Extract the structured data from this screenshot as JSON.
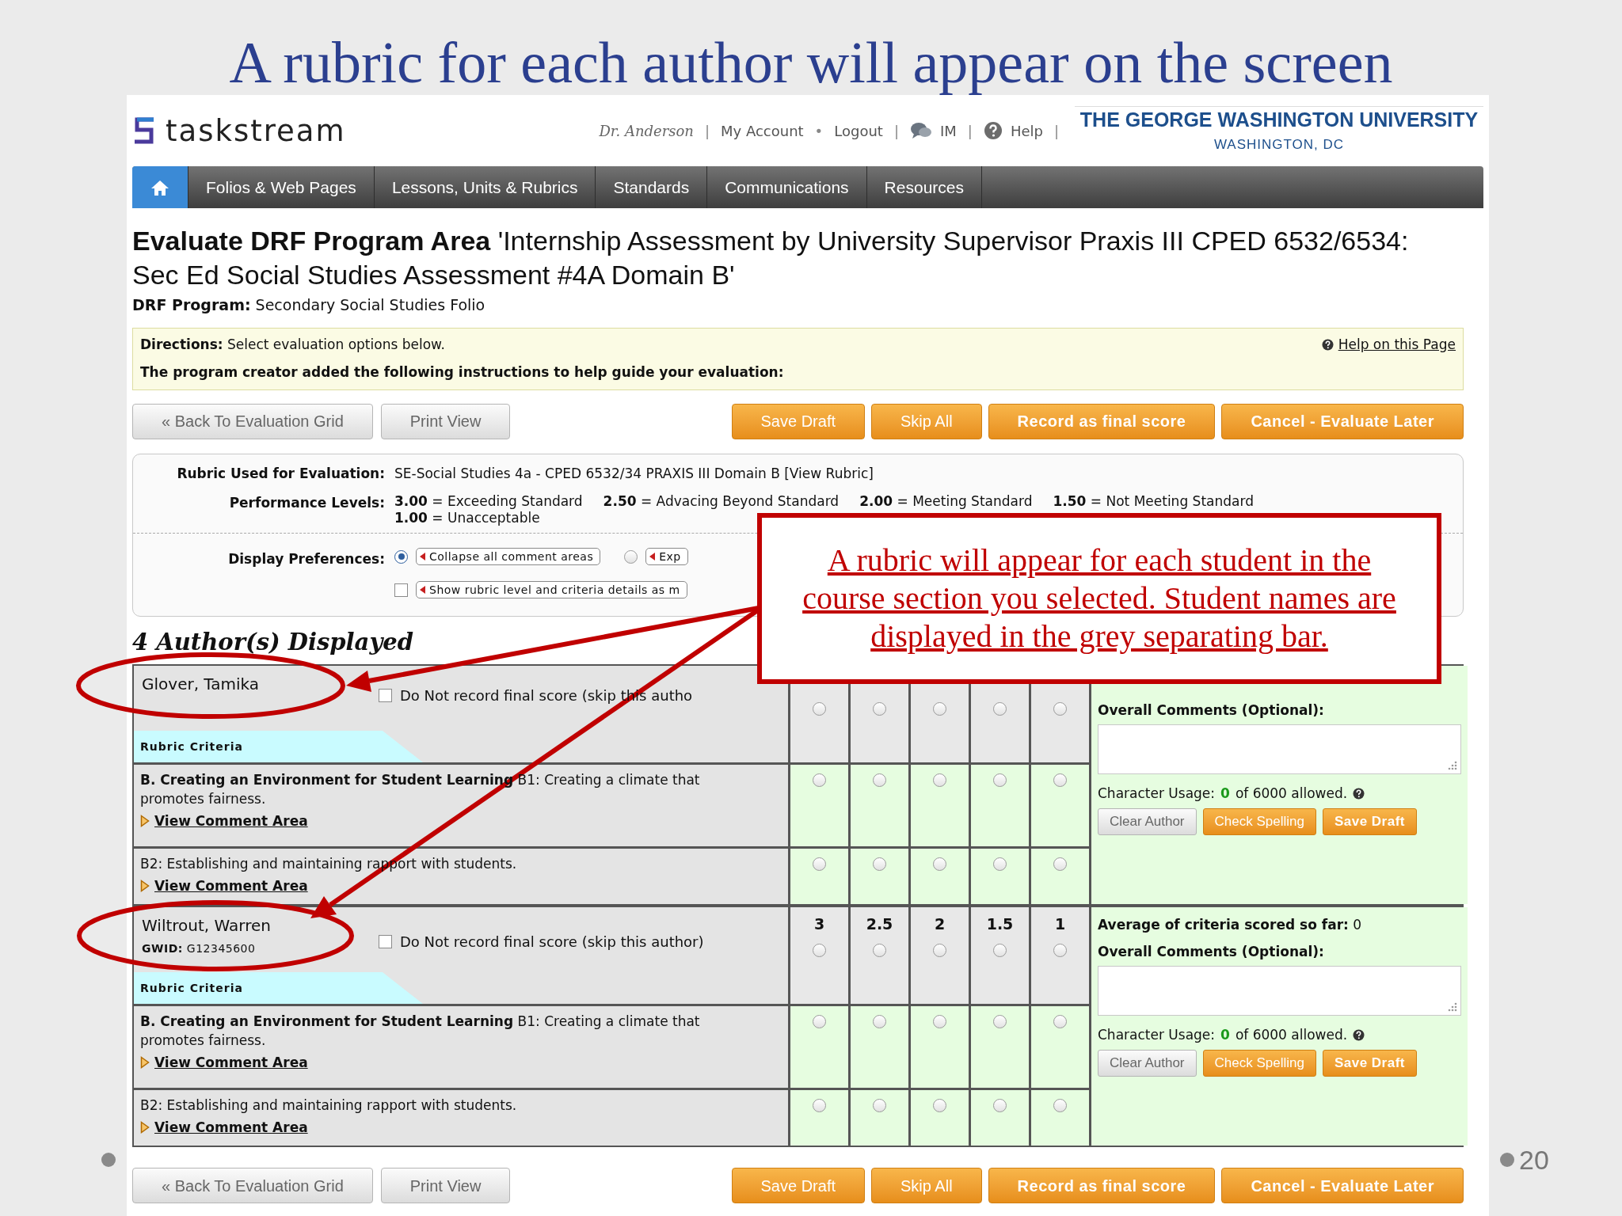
{
  "slide": {
    "title": "A rubric for each author will appear on the screen",
    "page_number": "20"
  },
  "header": {
    "logo": "taskstream",
    "items": [
      {
        "kind": "user",
        "label": "Dr. Anderson"
      },
      {
        "kind": "sep",
        "label": "|"
      },
      {
        "kind": "link",
        "label": "My Account"
      },
      {
        "kind": "sep",
        "label": "•"
      },
      {
        "kind": "link",
        "label": "Logout"
      },
      {
        "kind": "sep",
        "label": "|"
      },
      {
        "kind": "chat",
        "label": "IM"
      },
      {
        "kind": "sep",
        "label": "|"
      },
      {
        "kind": "help",
        "label": "Help"
      },
      {
        "kind": "sep",
        "label": "|"
      }
    ],
    "university": "THE GEORGE WASHINGTON UNIVERSITY",
    "location": "WASHINGTON, DC"
  },
  "nav": [
    {
      "kind": "home",
      "selected": true
    },
    {
      "kind": "link",
      "label": "Folios & Web Pages",
      "selected": false
    },
    {
      "kind": "link",
      "label": "Lessons, Units & Rubrics",
      "selected": false
    },
    {
      "kind": "link",
      "label": "Standards",
      "selected": false
    },
    {
      "kind": "link",
      "label": "Communications",
      "selected": false
    },
    {
      "kind": "link",
      "label": "Resources",
      "selected": false
    }
  ],
  "page": {
    "title": "**Evaluate DRF Program Area** 'Internship Assessment by University Supervisor Praxis III CPED 6532/6534: Sec Ed Social Studies Assessment #4A Domain B'",
    "program": "**DRF Program:** Secondary Social Studies Folio"
  },
  "directions": {
    "text": "**Directions:** Select evaluation options below.",
    "help": "Help on this Page",
    "instructions": "The program creator added the following instructions to help guide your evaluation:"
  },
  "actions_top": [
    {
      "label": "« Back To Evaluation Grid",
      "kind": "plain"
    },
    {
      "label": "Print View",
      "kind": "plain"
    },
    {
      "label": "Save Draft",
      "kind": "orange"
    },
    {
      "label": "Skip All",
      "kind": "orange"
    },
    {
      "label": "Record as final score",
      "kind": "primary"
    },
    {
      "label": "Cancel - Evaluate Later",
      "kind": "primary"
    }
  ],
  "rubric_info": {
    "rubric_label": "Rubric Used for Evaluation:",
    "rubric": "SE-Social Studies 4a - CPED 6532/34 PRAXIS III Domain B [View Rubric]",
    "levels_label": "Performance Levels:",
    "levels": [
      "**3.00** = Exceeding Standard",
      "**2.50** = Advacing Beyond Standard",
      "**2.00** = Meeting Standard",
      "**1.50** = Not Meeting Standard",
      "**1.00** = Unacceptable"
    ],
    "preferences_label": "Display Preferences:",
    "preferences": [
      {
        "kind": "radio",
        "label": "Collapse all comment areas",
        "selected": true
      },
      {
        "kind": "radio",
        "label": "Exp",
        "selected": false
      },
      {
        "kind": "checkbox",
        "label": "Show rubric level and criteria details as m",
        "checked": false
      }
    ]
  },
  "authors_heading": "4 Author(s) Displayed",
  "authors": [
    {
      "name": "Glover, Tamika",
      "skip_label": "Do Not record final score (skip this autho",
      "skip": false,
      "scores": [
        {
          "selected": false
        },
        {
          "selected": false
        },
        {
          "selected": false
        },
        {
          "selected": false
        },
        {
          "selected": false
        }
      ],
      "tab": "Rubric Criteria",
      "criteria": [
        {
          "text": "**B. Creating an Environment for Student Learning** B1: Creating a climate that promotes fairness.",
          "link": "View Comment Area",
          "ratings": [
            {
              "selected": false
            },
            {
              "selected": false
            },
            {
              "selected": false
            },
            {
              "selected": false
            },
            {
              "selected": false
            }
          ]
        },
        {
          "text": "B2: Establishing and maintaining rapport with students.",
          "link": "View Comment Area",
          "ratings": [
            {
              "selected": false
            },
            {
              "selected": false
            },
            {
              "selected": false
            },
            {
              "selected": false
            },
            {
              "selected": false
            }
          ]
        }
      ],
      "comments_label": "Overall Comments (Optional):",
      "usage_label": "Character Usage:",
      "usage_count": "0",
      "usage_limit": "of 6000 allowed.",
      "buttons": [
        {
          "label": "Clear Author",
          "kind": "plain"
        },
        {
          "label": "Check Spelling",
          "kind": "orange"
        },
        {
          "label": "Save Draft",
          "kind": "primary"
        }
      ]
    },
    {
      "name": "Wiltrout, Warren",
      "gwid": "**GWID:** G12345600",
      "skip_label": "Do Not record final score (skip this author)",
      "skip": false,
      "scores": [
        {
          "label": "3",
          "selected": false
        },
        {
          "label": "2.5",
          "selected": false
        },
        {
          "label": "2",
          "selected": false
        },
        {
          "label": "1.5",
          "selected": false
        },
        {
          "label": "1",
          "selected": false
        }
      ],
      "tab": "Rubric Criteria",
      "average": "**Average of criteria scored so far:** 0",
      "criteria": [
        {
          "text": "**B. Creating an Environment for Student Learning** B1: Creating a climate that promotes fairness.",
          "link": "View Comment Area",
          "ratings": [
            {
              "selected": false
            },
            {
              "selected": false
            },
            {
              "selected": false
            },
            {
              "selected": false
            },
            {
              "selected": false
            }
          ]
        },
        {
          "text": "B2: Establishing and maintaining rapport with students.",
          "link": "View Comment Area",
          "ratings": [
            {
              "selected": false
            },
            {
              "selected": false
            },
            {
              "selected": false
            },
            {
              "selected": false
            },
            {
              "selected": false
            }
          ]
        }
      ],
      "comments_label": "Overall Comments (Optional):",
      "usage_label": "Character Usage:",
      "usage_count": "0",
      "usage_limit": "of 6000 allowed.",
      "buttons": [
        {
          "label": "Clear Author",
          "kind": "plain"
        },
        {
          "label": "Check Spelling",
          "kind": "orange"
        },
        {
          "label": "Save Draft",
          "kind": "primary"
        }
      ]
    }
  ],
  "actions_bottom": [
    {
      "label": "« Back To Evaluation Grid",
      "kind": "plain"
    },
    {
      "label": "Print View",
      "kind": "plain"
    },
    {
      "label": "Save Draft",
      "kind": "orange"
    },
    {
      "label": "Skip All",
      "kind": "orange"
    },
    {
      "label": "Record as final score",
      "kind": "primary"
    },
    {
      "label": "Cancel - Evaluate Later",
      "kind": "primary"
    }
  ],
  "callout": {
    "text": "A rubric will appear for each student in the course section you selected. Student names are displayed in the grey separating bar."
  }
}
